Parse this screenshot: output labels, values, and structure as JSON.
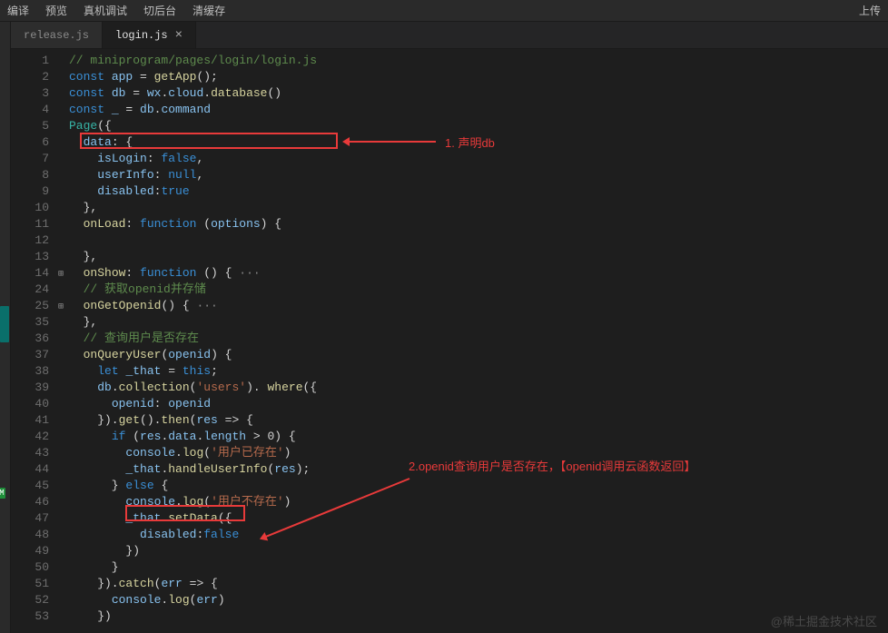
{
  "menubar": {
    "items": [
      "编译",
      "预览",
      "真机调试",
      "切后台",
      "清缓存"
    ],
    "right": "上传"
  },
  "tabs": [
    {
      "label": "release.js",
      "active": false
    },
    {
      "label": "login.js",
      "active": true
    }
  ],
  "gutter": {
    "lines": [
      "1",
      "2",
      "3",
      "4",
      "5",
      "6",
      "7",
      "8",
      "9",
      "10",
      "11",
      "12",
      "13",
      "14",
      "24",
      "25",
      "35",
      "36",
      "37",
      "38",
      "39",
      "40",
      "41",
      "42",
      "43",
      "44",
      "45",
      "46",
      "47",
      "48",
      "49",
      "50",
      "51",
      "52",
      "53"
    ],
    "folds": {
      "14": "⊞",
      "25": "⊞"
    }
  },
  "code": {
    "1": [
      [
        "tok-comment",
        "// miniprogram/pages/login/login.js"
      ]
    ],
    "2": [
      [
        "tok-storage",
        "const "
      ],
      [
        "tok-var",
        "app"
      ],
      [
        "tok-punct",
        " = "
      ],
      [
        "tok-fn",
        "getApp"
      ],
      [
        "tok-punct",
        "();"
      ]
    ],
    "3": [
      [
        "tok-storage",
        "const "
      ],
      [
        "tok-var",
        "db"
      ],
      [
        "tok-punct",
        " = "
      ],
      [
        "tok-var",
        "wx"
      ],
      [
        "tok-punct",
        "."
      ],
      [
        "tok-var",
        "cloud"
      ],
      [
        "tok-punct",
        "."
      ],
      [
        "tok-fn",
        "database"
      ],
      [
        "tok-punct",
        "()"
      ]
    ],
    "4": [
      [
        "tok-storage",
        "const "
      ],
      [
        "tok-var",
        "_"
      ],
      [
        "tok-punct",
        " = "
      ],
      [
        "tok-var",
        "db"
      ],
      [
        "tok-punct",
        "."
      ],
      [
        "tok-var",
        "command"
      ]
    ],
    "5": [
      [
        "tok-type",
        "Page"
      ],
      [
        "tok-punct",
        "({"
      ]
    ],
    "6": [
      [
        "tok-punct",
        "  "
      ],
      [
        "tok-prop",
        "data"
      ],
      [
        "tok-punct",
        ": {"
      ]
    ],
    "7": [
      [
        "tok-punct",
        "    "
      ],
      [
        "tok-prop",
        "isLogin"
      ],
      [
        "tok-punct",
        ": "
      ],
      [
        "tok-val",
        "false"
      ],
      [
        "tok-punct",
        ","
      ]
    ],
    "8": [
      [
        "tok-punct",
        "    "
      ],
      [
        "tok-prop",
        "userInfo"
      ],
      [
        "tok-punct",
        ": "
      ],
      [
        "tok-val",
        "null"
      ],
      [
        "tok-punct",
        ","
      ]
    ],
    "9": [
      [
        "tok-punct",
        "    "
      ],
      [
        "tok-prop",
        "disabled"
      ],
      [
        "tok-punct",
        ":"
      ],
      [
        "tok-val",
        "true"
      ]
    ],
    "10": [
      [
        "tok-punct",
        "  },"
      ]
    ],
    "11": [
      [
        "tok-punct",
        "  "
      ],
      [
        "tok-fn",
        "onLoad"
      ],
      [
        "tok-punct",
        ": "
      ],
      [
        "tok-kw",
        "function"
      ],
      [
        "tok-punct",
        " ("
      ],
      [
        "tok-var",
        "options"
      ],
      [
        "tok-punct",
        ") {"
      ]
    ],
    "12": [
      [
        "tok-punct",
        ""
      ]
    ],
    "13": [
      [
        "tok-punct",
        "  },"
      ]
    ],
    "14": [
      [
        "tok-punct",
        "  "
      ],
      [
        "tok-fn",
        "onShow"
      ],
      [
        "tok-punct",
        ": "
      ],
      [
        "tok-kw",
        "function"
      ],
      [
        "tok-punct",
        " () {"
      ],
      [
        "tok-grey",
        " ···"
      ]
    ],
    "24": [
      [
        "tok-punct",
        "  "
      ],
      [
        "tok-comment",
        "// 获取openid并存储"
      ]
    ],
    "25": [
      [
        "tok-punct",
        "  "
      ],
      [
        "tok-fn",
        "onGetOpenid"
      ],
      [
        "tok-punct",
        "() {"
      ],
      [
        "tok-grey",
        " ···"
      ]
    ],
    "35": [
      [
        "tok-punct",
        "  },"
      ]
    ],
    "36": [
      [
        "tok-punct",
        "  "
      ],
      [
        "tok-comment",
        "// 查询用户是否存在"
      ]
    ],
    "37": [
      [
        "tok-punct",
        "  "
      ],
      [
        "tok-fn",
        "onQueryUser"
      ],
      [
        "tok-punct",
        "("
      ],
      [
        "tok-var",
        "openid"
      ],
      [
        "tok-punct",
        ") {"
      ]
    ],
    "38": [
      [
        "tok-punct",
        "    "
      ],
      [
        "tok-kw",
        "let "
      ],
      [
        "tok-var",
        "_that"
      ],
      [
        "tok-punct",
        " = "
      ],
      [
        "tok-val",
        "this"
      ],
      [
        "tok-punct",
        ";"
      ]
    ],
    "39": [
      [
        "tok-punct",
        "    "
      ],
      [
        "tok-var",
        "db"
      ],
      [
        "tok-punct",
        "."
      ],
      [
        "tok-fn",
        "collection"
      ],
      [
        "tok-punct",
        "("
      ],
      [
        "tok-str",
        "'users'"
      ],
      [
        "tok-punct",
        "). "
      ],
      [
        "tok-fn",
        "where"
      ],
      [
        "tok-punct",
        "({"
      ]
    ],
    "40": [
      [
        "tok-punct",
        "      "
      ],
      [
        "tok-prop",
        "openid"
      ],
      [
        "tok-punct",
        ": "
      ],
      [
        "tok-var",
        "openid"
      ]
    ],
    "41": [
      [
        "tok-punct",
        "    })."
      ],
      [
        "tok-fn",
        "get"
      ],
      [
        "tok-punct",
        "()."
      ],
      [
        "tok-fn",
        "then"
      ],
      [
        "tok-punct",
        "("
      ],
      [
        "tok-var",
        "res"
      ],
      [
        "tok-punct",
        " => {"
      ]
    ],
    "42": [
      [
        "tok-punct",
        "      "
      ],
      [
        "tok-kw",
        "if"
      ],
      [
        "tok-punct",
        " ("
      ],
      [
        "tok-var",
        "res"
      ],
      [
        "tok-punct",
        "."
      ],
      [
        "tok-var",
        "data"
      ],
      [
        "tok-punct",
        "."
      ],
      [
        "tok-var",
        "length"
      ],
      [
        "tok-punct",
        " > 0) {"
      ]
    ],
    "43": [
      [
        "tok-punct",
        "        "
      ],
      [
        "tok-var",
        "console"
      ],
      [
        "tok-punct",
        "."
      ],
      [
        "tok-fn",
        "log"
      ],
      [
        "tok-punct",
        "("
      ],
      [
        "tok-str",
        "'用户已存在'"
      ],
      [
        "tok-punct",
        ")"
      ]
    ],
    "44": [
      [
        "tok-punct",
        "        "
      ],
      [
        "tok-var",
        "_that"
      ],
      [
        "tok-punct",
        "."
      ],
      [
        "tok-fn",
        "handleUserInfo"
      ],
      [
        "tok-punct",
        "("
      ],
      [
        "tok-var",
        "res"
      ],
      [
        "tok-punct",
        ");"
      ]
    ],
    "45": [
      [
        "tok-punct",
        "      } "
      ],
      [
        "tok-kw",
        "else"
      ],
      [
        "tok-punct",
        " {"
      ]
    ],
    "46": [
      [
        "tok-punct",
        "        "
      ],
      [
        "tok-var",
        "console"
      ],
      [
        "tok-punct",
        "."
      ],
      [
        "tok-fn",
        "log"
      ],
      [
        "tok-punct",
        "("
      ],
      [
        "tok-str",
        "'用户不存在'"
      ],
      [
        "tok-punct",
        ")"
      ]
    ],
    "47": [
      [
        "tok-punct",
        "        "
      ],
      [
        "tok-var",
        "_that"
      ],
      [
        "tok-punct",
        "."
      ],
      [
        "tok-fn",
        "setData"
      ],
      [
        "tok-punct",
        "({"
      ]
    ],
    "48": [
      [
        "tok-punct",
        "          "
      ],
      [
        "tok-prop",
        "disabled"
      ],
      [
        "tok-punct",
        ":"
      ],
      [
        "tok-val",
        "false"
      ]
    ],
    "49": [
      [
        "tok-punct",
        "        })"
      ]
    ],
    "50": [
      [
        "tok-punct",
        "      }"
      ]
    ],
    "51": [
      [
        "tok-punct",
        "    })."
      ],
      [
        "tok-fn",
        "catch"
      ],
      [
        "tok-punct",
        "("
      ],
      [
        "tok-var",
        "err"
      ],
      [
        "tok-punct",
        " => {"
      ]
    ],
    "52": [
      [
        "tok-punct",
        "      "
      ],
      [
        "tok-var",
        "console"
      ],
      [
        "tok-punct",
        "."
      ],
      [
        "tok-fn",
        "log"
      ],
      [
        "tok-punct",
        "("
      ],
      [
        "tok-var",
        "err"
      ],
      [
        "tok-punct",
        ")"
      ]
    ],
    "53": [
      [
        "tok-punct",
        "    })"
      ]
    ]
  },
  "annotations": {
    "a1": "1. 声明db",
    "a2": "2.openid查询用户是否存在，【openid调用云函数返回】"
  },
  "watermark": "@稀土掘金技术社区"
}
